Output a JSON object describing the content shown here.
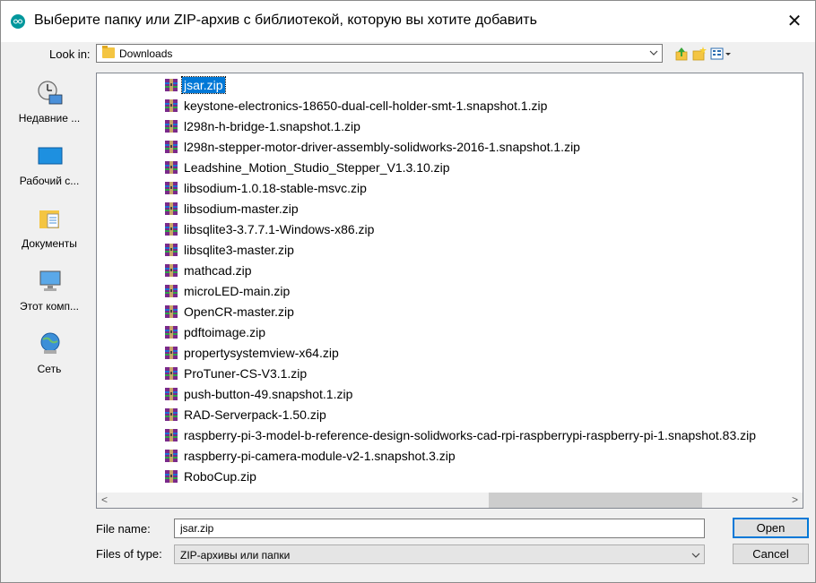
{
  "dialog": {
    "title": "Выберите папку или ZIP-архив с библиотекой, которую вы хотите добавить",
    "close_glyph": "✕"
  },
  "toolbar": {
    "look_in_label": "Look in:",
    "look_in_value": "Downloads",
    "icons": [
      "up-one-level-icon",
      "new-folder-icon",
      "view-menu-icon"
    ]
  },
  "places": [
    {
      "label": "Недавние ...",
      "icon": "recent-places-icon"
    },
    {
      "label": "Рабочий с...",
      "icon": "desktop-icon"
    },
    {
      "label": "Документы",
      "icon": "documents-icon"
    },
    {
      "label": "Этот комп...",
      "icon": "this-pc-icon"
    },
    {
      "label": "Сеть",
      "icon": "network-icon"
    }
  ],
  "files": [
    {
      "name": "jsar.zip",
      "selected": true
    },
    {
      "name": "keystone-electronics-18650-dual-cell-holder-smt-1.snapshot.1.zip"
    },
    {
      "name": "l298n-h-bridge-1.snapshot.1.zip"
    },
    {
      "name": "l298n-stepper-motor-driver-assembly-solidworks-2016-1.snapshot.1.zip"
    },
    {
      "name": "Leadshine_Motion_Studio_Stepper_V1.3.10.zip"
    },
    {
      "name": "libsodium-1.0.18-stable-msvc.zip"
    },
    {
      "name": "libsodium-master.zip"
    },
    {
      "name": "libsqlite3-3.7.7.1-Windows-x86.zip"
    },
    {
      "name": "libsqlite3-master.zip"
    },
    {
      "name": "mathcad.zip"
    },
    {
      "name": "microLED-main.zip"
    },
    {
      "name": "OpenCR-master.zip"
    },
    {
      "name": "pdftoimage.zip"
    },
    {
      "name": "propertysystemview-x64.zip"
    },
    {
      "name": "ProTuner-CS-V3.1.zip"
    },
    {
      "name": "push-button-49.snapshot.1.zip"
    },
    {
      "name": "RAD-Serverpack-1.50.zip"
    },
    {
      "name": "raspberry-pi-3-model-b-reference-design-solidworks-cad-rpi-raspberrypi-raspberry-pi-1.snapshot.83.zip"
    },
    {
      "name": "raspberry-pi-camera-module-v2-1.snapshot.3.zip"
    },
    {
      "name": "RoboCup.zip"
    }
  ],
  "scrollbar": {
    "left_arrow": "<",
    "right_arrow": ">"
  },
  "footer": {
    "file_name_label": "File name:",
    "file_name_value": "jsar.zip",
    "file_type_label": "Files of type:",
    "file_type_value": "ZIP-архивы или папки",
    "open_label": "Open",
    "cancel_label": "Cancel"
  },
  "colors": {
    "selection": "#0078d7",
    "app_icon": "#00979c",
    "folder": "#f4c542"
  }
}
